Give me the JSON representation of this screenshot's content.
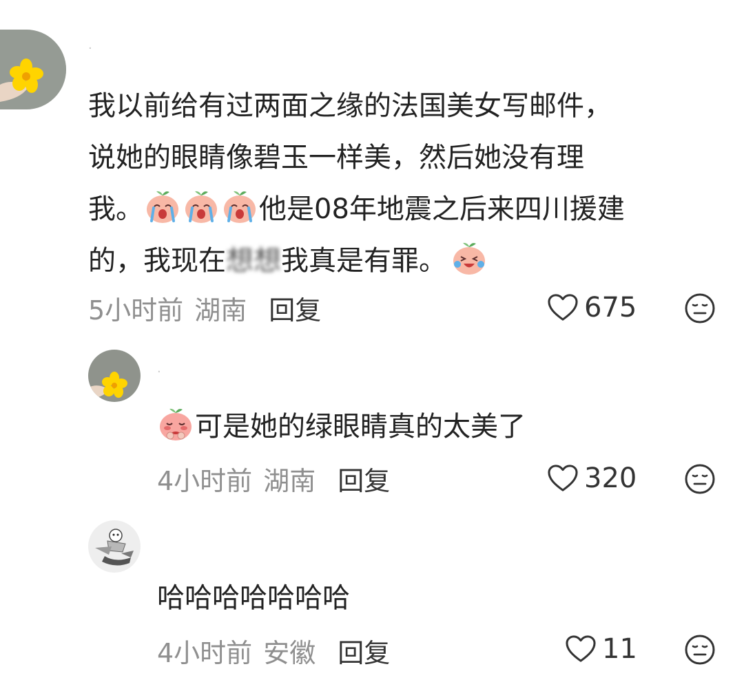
{
  "comments": [
    {
      "username": "·",
      "lines": [
        "我以前给有过两面之缘的法国美女写邮件，",
        "说她的眼睛像碧玉一样美，然后她没有理"
      ],
      "line3_start": "我。",
      "line3_end": "他是08年地震之后来四川援建",
      "line4_start": "的，我现在",
      "line4_blur": "想想",
      "line4_end": "我真是有罪。",
      "time": "5小时前",
      "location": "湖南",
      "reply_label": "回复",
      "likes": "675"
    },
    {
      "username": "·",
      "text": "可是她的绿眼睛真的太美了",
      "time": "4小时前",
      "location": "湖南",
      "reply_label": "回复",
      "likes": "320"
    },
    {
      "username": "",
      "text": "哈哈哈哈哈哈哈",
      "time": "4小时前",
      "location": "安徽",
      "reply_label": "回复",
      "likes": "11"
    }
  ],
  "icons": {
    "like": "heart-outline-icon",
    "more": "neutral-face-icon",
    "emoji_cry": "crying-peach-emoji",
    "emoji_laugh_cry": "laughing-tears-peach-emoji",
    "emoji_shy": "shy-peach-emoji"
  }
}
